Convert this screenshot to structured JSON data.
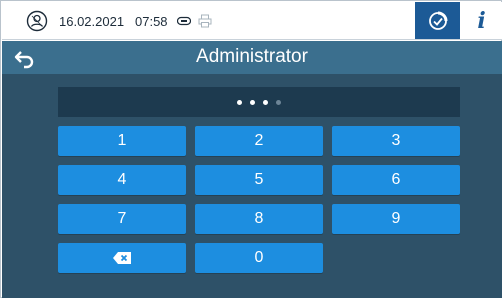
{
  "status": {
    "date": "16.02.2021",
    "time": "07:58",
    "logo_icon": "user-circle-icon",
    "usb_icon": "usb-icon",
    "printer_icon": "printer-icon",
    "program_icon": "program-cycle-icon",
    "info_label": "i"
  },
  "header": {
    "title": "Administrator",
    "back_icon": "back-arrow-icon"
  },
  "pin": {
    "entered": 3,
    "length": 4
  },
  "keypad": {
    "k1": "1",
    "k2": "2",
    "k3": "3",
    "k4": "4",
    "k5": "5",
    "k6": "6",
    "k7": "7",
    "k8": "8",
    "k9": "9",
    "k0": "0",
    "backspace_icon": "backspace-icon"
  },
  "colors": {
    "accent": "#1d8ee0",
    "title_bar": "#3b6f8e",
    "background": "#2e5168",
    "display": "#1d3a4f",
    "program_button": "#1c5a96"
  }
}
